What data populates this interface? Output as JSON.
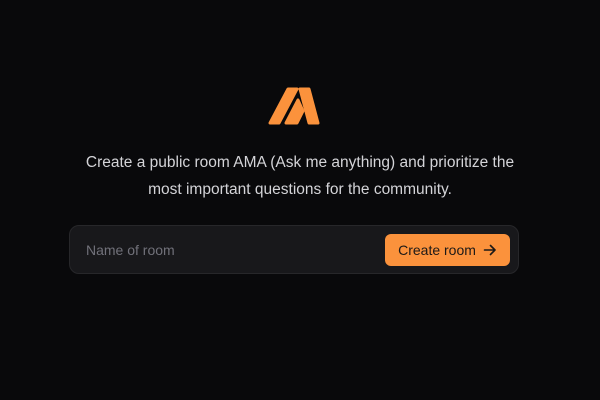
{
  "brand": {
    "logo_icon": "ama-logo-icon",
    "accent_color": "#fb923c",
    "background_color": "#09090b"
  },
  "hero": {
    "tagline_line1": "Create a public room AMA (Ask me anything) and prioritize the",
    "tagline_line2": "most important questions for the community."
  },
  "form": {
    "room_name_placeholder": "Name of room",
    "room_name_value": "",
    "submit_label": "Create room",
    "submit_icon": "arrow-right-icon"
  }
}
